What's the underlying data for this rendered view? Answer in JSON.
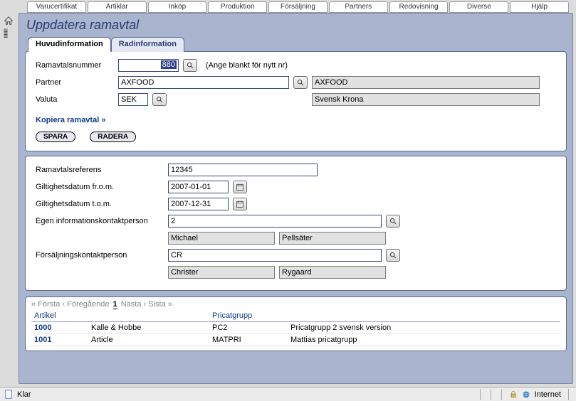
{
  "menu": [
    "Varucertifikat",
    "Artiklar",
    "Inköp",
    "Produktion",
    "Försäljning",
    "Partners",
    "Redovisning",
    "Diverse",
    "Hjälp"
  ],
  "title": "Uppdatera ramavtal",
  "tabs": {
    "main": "Huvudinformation",
    "rows": "Radinformation"
  },
  "labels": {
    "ramno": "Ramavtalsnummer",
    "ramno_hint": "(Ange blankt för nytt nr)",
    "partner": "Partner",
    "valuta": "Valuta",
    "copy": "Kopiera ramavtal »",
    "save": "SPARA",
    "delete": "RADERA",
    "ref": "Ramavtalsreferens",
    "from": "Giltighetsdatum fr.o.m.",
    "to": "Giltighetsdatum t.o.m.",
    "owncontact": "Egen informationskontaktperson",
    "salescontact": "Försäljningskontaktperson"
  },
  "values": {
    "ramno": "880",
    "partner_code": "AXFOOD",
    "partner_name": "AXFOOD",
    "valuta_code": "SEK",
    "valuta_name": "Svensk Krona",
    "ref": "12345",
    "from": "2007-01-01",
    "to": "2007-12-31",
    "owncontact_code": "2",
    "own_first": "Michael",
    "own_last": "Pellsäter",
    "sales_code": "CR",
    "sales_first": "Christer",
    "sales_last": "Rygaard"
  },
  "pager": {
    "first": "Första",
    "prev": "Föregående",
    "page": "1",
    "next": "Nästa",
    "last": "Sista"
  },
  "table": {
    "headers": [
      "Artikel",
      "",
      "Pricatgrupp",
      ""
    ],
    "rows": [
      {
        "art": "1000",
        "artname": "Kalle & Hobbe",
        "pg": "PC2",
        "pgname": "Pricatgrupp 2 svensk version"
      },
      {
        "art": "1001",
        "artname": "Article",
        "pg": "MATPRI",
        "pgname": "Mattias pricatgrupp"
      }
    ]
  },
  "status": {
    "left": "Klar",
    "zone": "Internet"
  }
}
